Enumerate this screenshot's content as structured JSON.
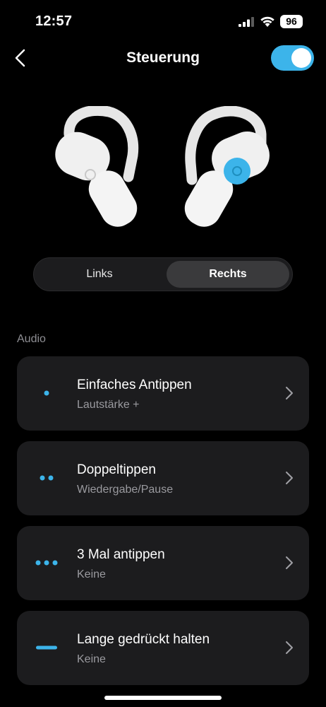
{
  "status_bar": {
    "time": "12:57",
    "battery": "96"
  },
  "header": {
    "title": "Steuerung",
    "back_icon": "chevron-left-icon",
    "toggle_on": true
  },
  "segmented": {
    "left_label": "Links",
    "right_label": "Rechts",
    "selected": "Rechts"
  },
  "section": {
    "label": "Audio"
  },
  "controls": [
    {
      "title": "Einfaches Antippen",
      "value": "Lautstärke +",
      "icon": "single-dot-icon"
    },
    {
      "title": "Doppeltippen",
      "value": "Wiedergabe/Pause",
      "icon": "double-dot-icon"
    },
    {
      "title": "3 Mal antippen",
      "value": "Keine",
      "icon": "triple-dot-icon"
    },
    {
      "title": "Lange gedrückt halten",
      "value": "Keine",
      "icon": "long-press-icon"
    }
  ],
  "colors": {
    "accent": "#3cb4ea",
    "card": "#1c1c1e",
    "background": "#000000"
  }
}
